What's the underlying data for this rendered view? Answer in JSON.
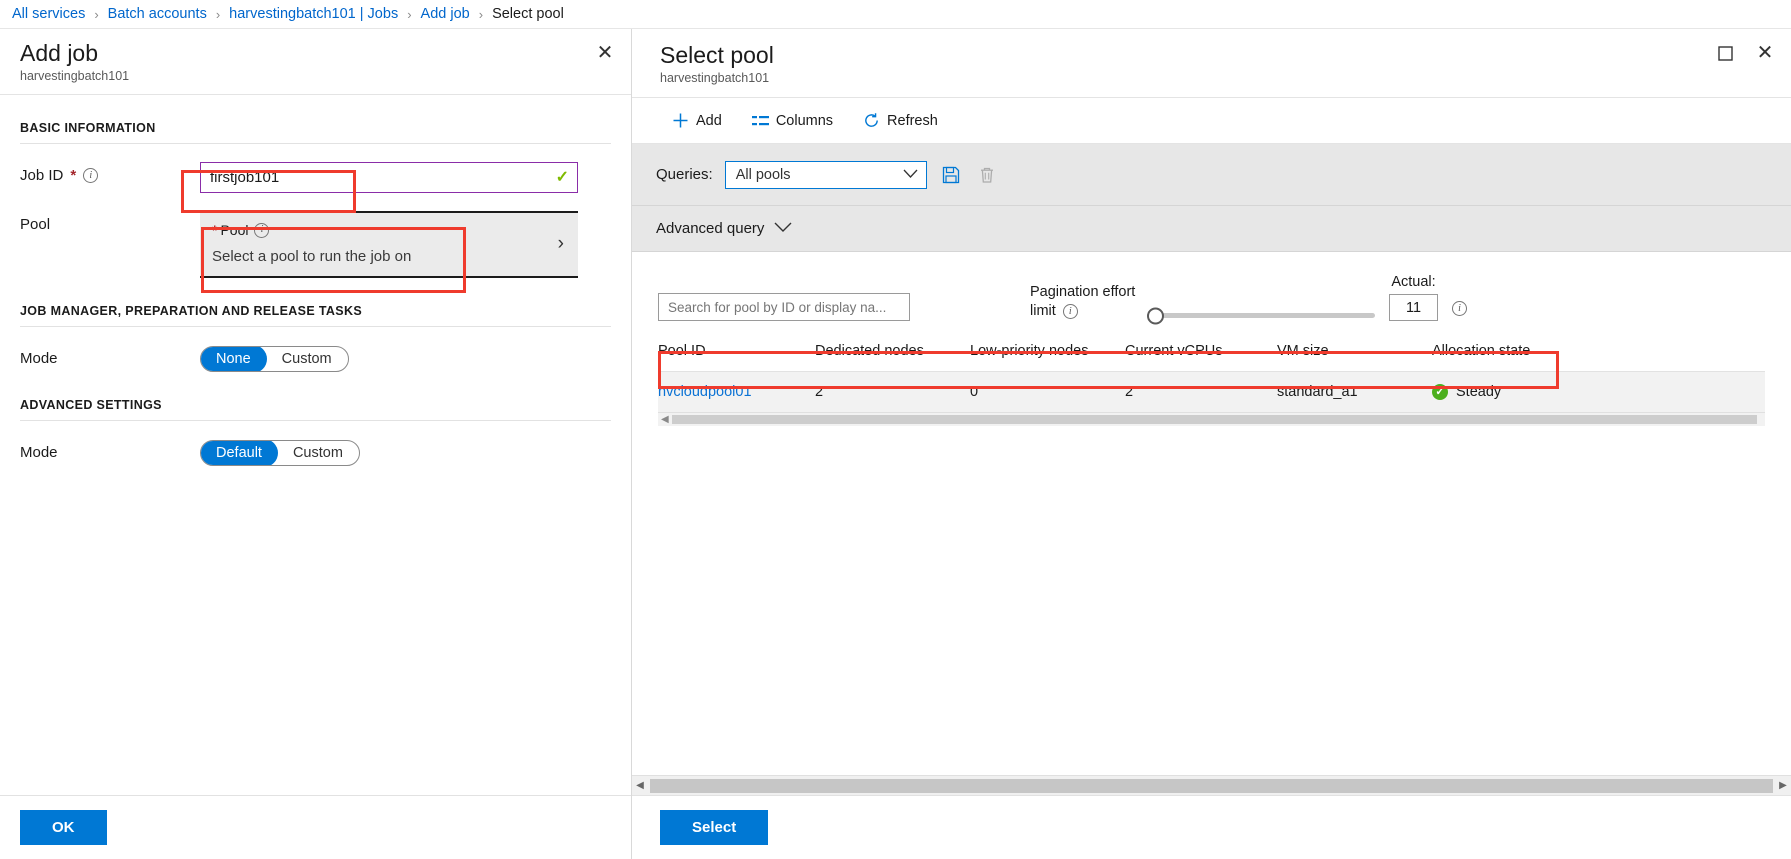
{
  "breadcrumb": {
    "items": [
      {
        "label": "All services",
        "current": false
      },
      {
        "label": "Batch accounts",
        "current": false
      },
      {
        "label": "harvestingbatch101 | Jobs",
        "current": false
      },
      {
        "label": "Add job",
        "current": false
      },
      {
        "label": "Select pool",
        "current": true
      }
    ],
    "separator": "›"
  },
  "add_job_blade": {
    "title": "Add job",
    "subtitle": "harvestingbatch101",
    "close_icon": "✕",
    "sections": {
      "basic": "BASIC INFORMATION",
      "job_manager": "JOB MANAGER, PREPARATION AND RELEASE TASKS",
      "advanced": "ADVANCED SETTINGS"
    },
    "job_id": {
      "label": "Job ID",
      "required_mark": "*",
      "info_icon": "i",
      "value": "firstjob101",
      "valid_icon": "✓"
    },
    "pool": {
      "label": "Pool",
      "picker_title": "Pool",
      "picker_required_mark": "*",
      "picker_info_icon": "i",
      "picker_value": "Select a pool to run the job on",
      "chevron_icon": "›"
    },
    "job_manager_mode": {
      "label": "Mode",
      "options": [
        "None",
        "Custom"
      ],
      "selected": "None"
    },
    "advanced_mode": {
      "label": "Mode",
      "options": [
        "Default",
        "Custom"
      ],
      "selected": "Default"
    },
    "ok_button": "OK"
  },
  "select_pool_blade": {
    "title": "Select pool",
    "subtitle": "harvestingbatch101",
    "maximize_icon": "☐",
    "close_icon": "✕",
    "toolbar": [
      {
        "label": "Add",
        "icon": "plus-icon",
        "glyph": "+"
      },
      {
        "label": "Columns",
        "icon": "columns-icon",
        "glyph": ""
      },
      {
        "label": "Refresh",
        "icon": "refresh-icon",
        "glyph": ""
      }
    ],
    "queries": {
      "label": "Queries:",
      "selected": "All pools",
      "chevron_icon": "∨",
      "save_icon": "save-icon",
      "delete_icon": "trash-icon"
    },
    "advanced_query": {
      "label": "Advanced query",
      "chevron_icon": "∨"
    },
    "search": {
      "placeholder": "Search for pool by ID or display na..."
    },
    "pagination": {
      "label_line1": "Pagination effort",
      "label_line2": "limit",
      "info_icon": "i",
      "slider_value": 0,
      "slider_min": 0,
      "slider_max": 100,
      "actual_label": "Actual:",
      "actual_value": "11",
      "actual_info_icon": "i"
    },
    "table": {
      "columns": [
        "Pool ID",
        "Dedicated nodes",
        "Low-priority nodes",
        "Current vCPUs",
        "VM size",
        "Allocation state"
      ],
      "rows": [
        {
          "pool_id": "hvcloudpool01",
          "dedicated_nodes": "2",
          "low_priority_nodes": "0",
          "current_vcpus": "2",
          "vm_size": "standard_a1",
          "allocation_state": "Steady",
          "allocation_state_icon": "✓"
        }
      ]
    },
    "select_button": "Select",
    "scroll_left_icon": "◀",
    "scroll_right_icon": "▶"
  },
  "colors": {
    "accent": "#0078d4",
    "link": "#0066cc",
    "annotation": "#ef3b2d",
    "validated_border": "#8a2da8",
    "success": "#4caf1e",
    "required": "#a4262c"
  }
}
